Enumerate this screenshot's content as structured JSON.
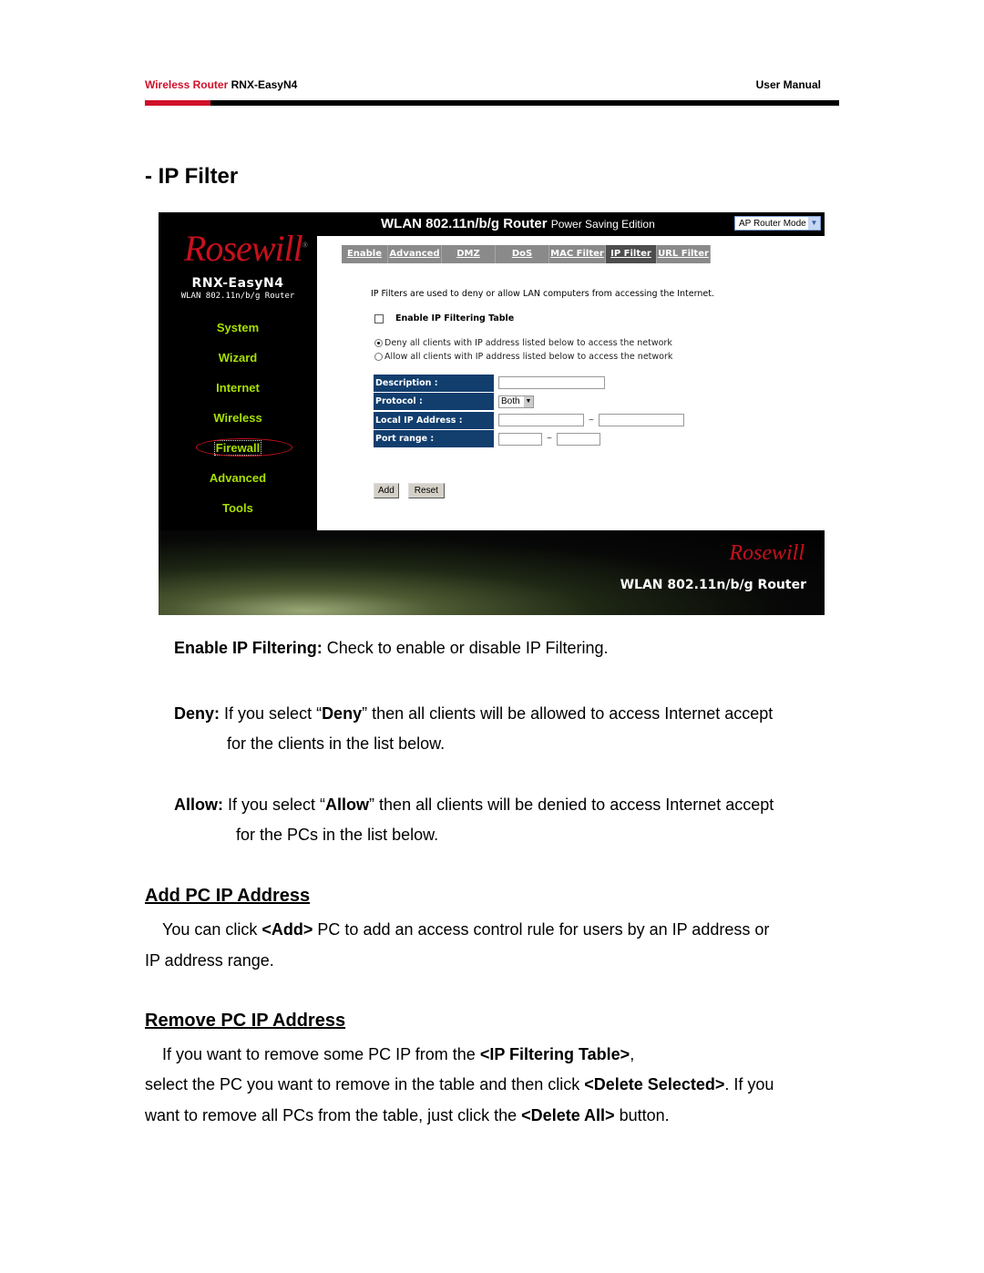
{
  "header": {
    "product": "Wireless Router",
    "model": "RNX-EasyN4",
    "doc_type": "User Manual",
    "accent_color": "#d0102a"
  },
  "title": "- IP Filter",
  "router_ui": {
    "brand": "Rosewill",
    "model": "RNX-EasyN4",
    "model_sub": "WLAN 802.11n/b/g Router",
    "top_title": "WLAN 802.11n/b/g Router",
    "top_subtitle": "Power Saving Edition",
    "mode_select": {
      "value": "AP Router Mode"
    },
    "nav": [
      {
        "label": "System"
      },
      {
        "label": "Wizard"
      },
      {
        "label": "Internet"
      },
      {
        "label": "Wireless"
      },
      {
        "label": "Firewall",
        "active": true
      },
      {
        "label": "Advanced"
      },
      {
        "label": "Tools"
      }
    ],
    "tabs": [
      {
        "label": "Enable"
      },
      {
        "label": "Advanced"
      },
      {
        "label": "DMZ"
      },
      {
        "label": "DoS"
      },
      {
        "label": "MAC Filter"
      },
      {
        "label": "IP Filter",
        "active": true
      },
      {
        "label": "URL Filter"
      }
    ],
    "intro": "IP Filters are used to deny or allow LAN computers from accessing the Internet.",
    "enable_label": "Enable IP Filtering Table",
    "enable_checked": false,
    "radio_deny": "Deny all clients with IP address listed below to access the network",
    "radio_allow": "Allow all clients with IP address listed below to access the network",
    "selected_radio": "deny",
    "form": {
      "description_label": "Description :",
      "description_value": "",
      "protocol_label": "Protocol :",
      "protocol_value": "Both",
      "local_ip_label": "Local IP Address :",
      "local_ip_from": "",
      "local_ip_to": "",
      "port_range_label": "Port range :",
      "port_from": "",
      "port_to": "",
      "range_separator": "~"
    },
    "buttons": {
      "add": "Add",
      "reset": "Reset"
    },
    "banner_brand": "Rosewill",
    "banner_text": "WLAN 802.11n/b/g Router"
  },
  "body": {
    "enable_term": "Enable IP Filtering:",
    "enable_desc": " Check to enable or disable IP Filtering.",
    "deny_term": "Deny:",
    "deny_pre": " If you select “",
    "deny_word": "Deny",
    "deny_post": "” then all clients will be allowed to access Internet accept",
    "deny_line2": "for the clients in the list below.",
    "allow_term": "Allow:",
    "allow_pre": " If you select “",
    "allow_word": "Allow",
    "allow_post": "” then all clients will be denied to access Internet accept",
    "allow_line2": "for the PCs in the list below.",
    "add_heading": "Add PC IP Address",
    "add_pre": "You can click ",
    "add_btn": "<Add>",
    "add_post": " PC to add an access control rule for users by an IP address or",
    "add_line2": "IP address range.",
    "remove_heading": "Remove PC IP Address",
    "remove_pre": "If you want to remove some PC IP from the ",
    "remove_table": "<IP Filtering Table>",
    "remove_post": ",",
    "remove_line2_pre": "select the PC you want to remove in the table and then click ",
    "remove_delete_selected": "<Delete Selected>",
    "remove_line2_post": ". If you",
    "remove_line3_pre": "want to remove all PCs from the table, just click the ",
    "remove_delete_all": "<Delete All>",
    "remove_line3_post": " button."
  }
}
